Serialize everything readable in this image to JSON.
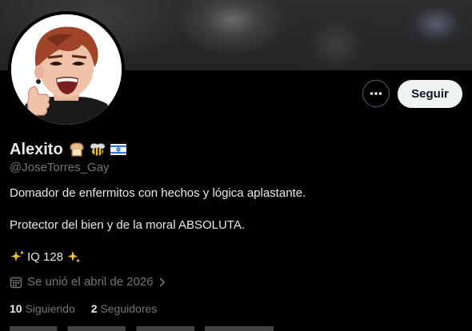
{
  "profile": {
    "display_name": "Alexito",
    "handle": "@JoseTorres_Gay",
    "name_emojis": [
      "bread-emoji",
      "bee-emoji",
      "israel-flag-emoji"
    ],
    "bio": {
      "line1": "Domador de enfermitos con hechos y lógica aplastante.",
      "line2": "Protector del bien y de la moral ABSOLUTA.",
      "line3": "IQ 128"
    },
    "joined": "Se unió el abril de 2026"
  },
  "actions": {
    "more_icon": "more-horizontal-icon",
    "follow_label": "Seguir"
  },
  "stats": {
    "following_count": "10",
    "following_label": "Siguiendo",
    "followers_count": "2",
    "followers_label": "Seguidores"
  },
  "colors": {
    "background": "#000000",
    "primary_text": "#e7e9ea",
    "secondary_text": "#71767b",
    "follow_button_bg": "#eff3f4",
    "border": "#536471"
  }
}
